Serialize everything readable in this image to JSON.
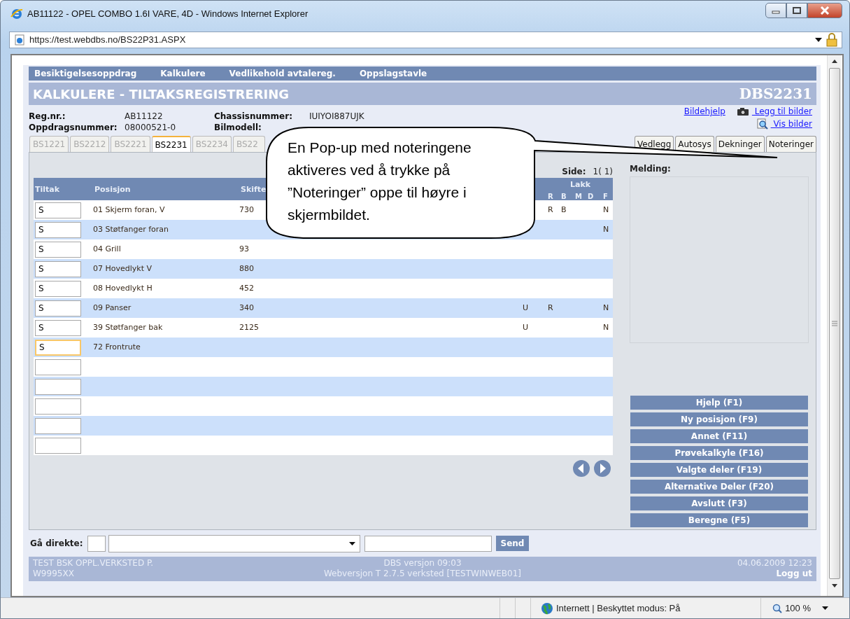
{
  "window": {
    "title": "AB11122 - OPEL COMBO 1.6I VARE, 4D - Windows Internet Explorer"
  },
  "address_bar": {
    "url": "https://test.webdbs.no/BS22P31.ASPX"
  },
  "menu": [
    "Besiktigelsesoppdrag",
    "Kalkulere",
    "Vedlikehold avtalereg.",
    "Oppslagstavle"
  ],
  "page_title": "KALKULERE - TILTAKSREGISTRERING",
  "page_code": "DBS2231",
  "info": [
    {
      "label": "Reg.nr.:",
      "value": "AB11122"
    },
    {
      "label": "Chassisnummer:",
      "value": "IUIYOI887UJK"
    },
    {
      "label": "Oppdragsnummer:",
      "value": "08000521-0"
    },
    {
      "label": "Bilmodell:"
    }
  ],
  "links": [
    {
      "label": "Bildehjelp",
      "kind": "plain"
    },
    {
      "label": " Legg til bilder",
      "kind": "camera"
    },
    {
      "label": " Vis bilder",
      "kind": "magnifier"
    }
  ],
  "tabs": [
    {
      "label": "BS1221",
      "selected": false
    },
    {
      "label": "BS2212",
      "selected": false
    },
    {
      "label": "BS2221",
      "selected": false
    },
    {
      "label": "BS2231",
      "selected": true
    },
    {
      "label": "BS2234",
      "selected": false
    },
    {
      "label": "BS22",
      "selected": false
    }
  ],
  "side_tabs": [
    "Vedlegg",
    "Autosys",
    "Dekninger",
    "Noteringer"
  ],
  "pager": {
    "label": "Side:",
    "value": "1( 1)"
  },
  "table": {
    "columns": [
      "Tiltak",
      "Posisjon",
      "Skifte"
    ],
    "group_header": "Lakk",
    "sub_columns": [
      "R",
      "B",
      "M",
      "D",
      "F"
    ],
    "rows": [
      {
        "tiltak": "S",
        "posisjon": "01 Skjerm foran, V",
        "skifte": "730",
        "lakk_r": "R",
        "lakk_b": "B",
        "lakk_f": "N",
        "focused": false
      },
      {
        "tiltak": "S",
        "posisjon": "03 Støtfanger foran",
        "lakk_f": "N",
        "focused": false
      },
      {
        "tiltak": "S",
        "posisjon": "04 Grill",
        "skifte": "93",
        "focused": false
      },
      {
        "tiltak": "S",
        "posisjon": "07 Hovedlykt V",
        "skifte": "880",
        "focused": false
      },
      {
        "tiltak": "S",
        "posisjon": "08 Hovedlykt H",
        "skifte": "452",
        "focused": false
      },
      {
        "tiltak": "S",
        "posisjon": "09 Panser",
        "skifte": "340",
        "column_4": "U",
        "lakk_r": "R",
        "lakk_f": "N",
        "focused": false
      },
      {
        "tiltak": "S",
        "posisjon": "39 Støtfanger bak",
        "skifte": "2125",
        "column_4": "U",
        "lakk_f": "N",
        "focused": false
      },
      {
        "tiltak": "S",
        "posisjon": "72 Frontrute",
        "focused": true
      },
      {
        "focused": false
      },
      {
        "focused": false
      },
      {
        "focused": false
      },
      {
        "focused": false
      },
      {
        "focused": false
      }
    ]
  },
  "message": {
    "label": "Melding:"
  },
  "actions": [
    "Hjelp (F1)",
    "Ny posisjon (F9)",
    "Annet (F11)",
    "Prøvekalkyle (F16)",
    "Valgte deler (F19)",
    "Alternative Deler (F20)",
    "Avslutt (F3)",
    "Beregne (F5)"
  ],
  "goto": {
    "label": "Gå direkte:",
    "button": "Send"
  },
  "footer": {
    "left": [
      "TEST BSK OPPL.VERKSTED P.",
      "W9995XX"
    ],
    "center": [
      "DBS versjon 09:03",
      "Webversjon T 2.7.5 verksted [TESTWINWEB01]"
    ],
    "right": "04.06.2009 12:23",
    "logout": "Logg ut"
  },
  "status_bar": {
    "zone": "Internett | Beskyttet modus: På",
    "zoom": "100 %"
  },
  "callout": {
    "text": "En Pop-up med noteringene aktiveres ved å trykke på ”Noteringer” oppe til høyre i skjermbildet."
  }
}
